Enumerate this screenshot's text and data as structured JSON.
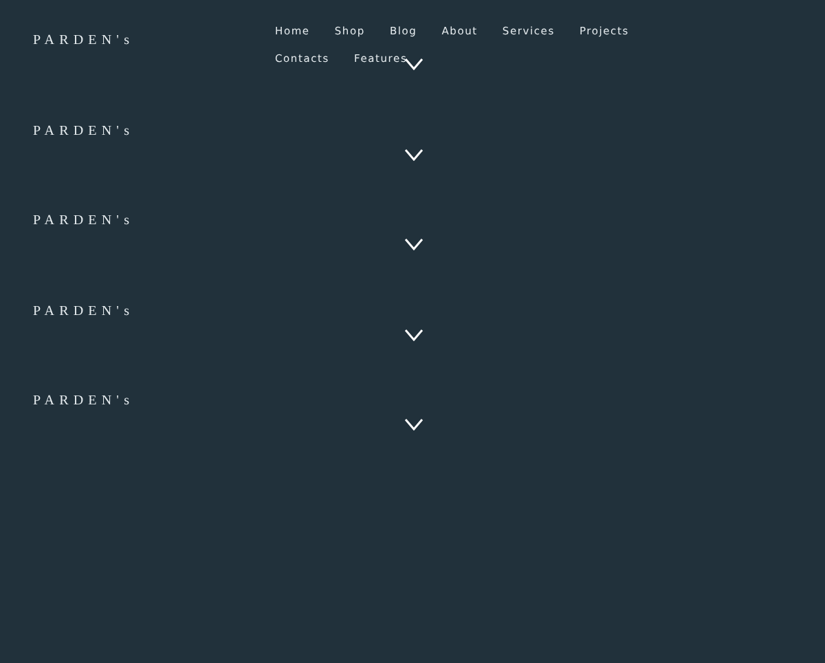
{
  "nav": [
    {
      "label": "Home"
    },
    {
      "label": "Shop"
    },
    {
      "label": "Blog"
    },
    {
      "label": "About"
    },
    {
      "label": "Services"
    },
    {
      "label": "Projects"
    },
    {
      "label": "Contacts"
    },
    {
      "label": "Features"
    }
  ],
  "sections": [
    {
      "logo": "PARDEN's"
    },
    {
      "logo": "PARDEN's"
    },
    {
      "logo": "PARDEN's"
    },
    {
      "logo": "PARDEN's"
    },
    {
      "logo": "PARDEN's"
    }
  ]
}
